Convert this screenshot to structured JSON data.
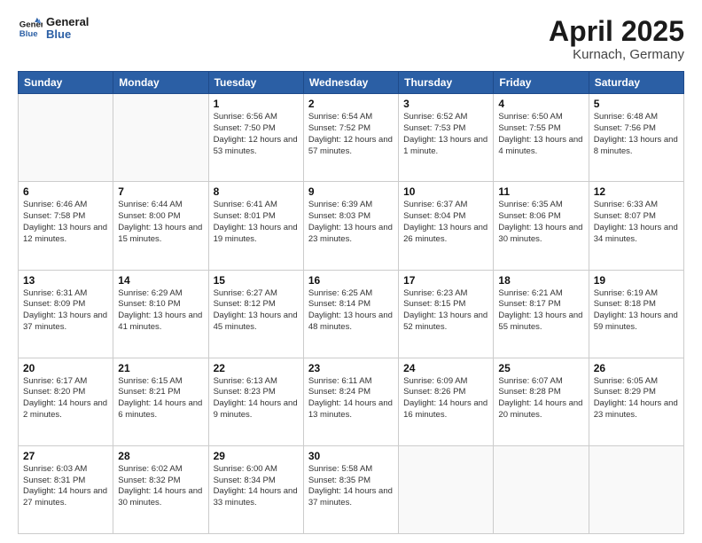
{
  "header": {
    "logo_line1": "General",
    "logo_line2": "Blue",
    "month": "April 2025",
    "location": "Kurnach, Germany"
  },
  "days_of_week": [
    "Sunday",
    "Monday",
    "Tuesday",
    "Wednesday",
    "Thursday",
    "Friday",
    "Saturday"
  ],
  "weeks": [
    [
      {
        "day": "",
        "info": ""
      },
      {
        "day": "",
        "info": ""
      },
      {
        "day": "1",
        "info": "Sunrise: 6:56 AM\nSunset: 7:50 PM\nDaylight: 12 hours\nand 53 minutes."
      },
      {
        "day": "2",
        "info": "Sunrise: 6:54 AM\nSunset: 7:52 PM\nDaylight: 12 hours\nand 57 minutes."
      },
      {
        "day": "3",
        "info": "Sunrise: 6:52 AM\nSunset: 7:53 PM\nDaylight: 13 hours\nand 1 minute."
      },
      {
        "day": "4",
        "info": "Sunrise: 6:50 AM\nSunset: 7:55 PM\nDaylight: 13 hours\nand 4 minutes."
      },
      {
        "day": "5",
        "info": "Sunrise: 6:48 AM\nSunset: 7:56 PM\nDaylight: 13 hours\nand 8 minutes."
      }
    ],
    [
      {
        "day": "6",
        "info": "Sunrise: 6:46 AM\nSunset: 7:58 PM\nDaylight: 13 hours\nand 12 minutes."
      },
      {
        "day": "7",
        "info": "Sunrise: 6:44 AM\nSunset: 8:00 PM\nDaylight: 13 hours\nand 15 minutes."
      },
      {
        "day": "8",
        "info": "Sunrise: 6:41 AM\nSunset: 8:01 PM\nDaylight: 13 hours\nand 19 minutes."
      },
      {
        "day": "9",
        "info": "Sunrise: 6:39 AM\nSunset: 8:03 PM\nDaylight: 13 hours\nand 23 minutes."
      },
      {
        "day": "10",
        "info": "Sunrise: 6:37 AM\nSunset: 8:04 PM\nDaylight: 13 hours\nand 26 minutes."
      },
      {
        "day": "11",
        "info": "Sunrise: 6:35 AM\nSunset: 8:06 PM\nDaylight: 13 hours\nand 30 minutes."
      },
      {
        "day": "12",
        "info": "Sunrise: 6:33 AM\nSunset: 8:07 PM\nDaylight: 13 hours\nand 34 minutes."
      }
    ],
    [
      {
        "day": "13",
        "info": "Sunrise: 6:31 AM\nSunset: 8:09 PM\nDaylight: 13 hours\nand 37 minutes."
      },
      {
        "day": "14",
        "info": "Sunrise: 6:29 AM\nSunset: 8:10 PM\nDaylight: 13 hours\nand 41 minutes."
      },
      {
        "day": "15",
        "info": "Sunrise: 6:27 AM\nSunset: 8:12 PM\nDaylight: 13 hours\nand 45 minutes."
      },
      {
        "day": "16",
        "info": "Sunrise: 6:25 AM\nSunset: 8:14 PM\nDaylight: 13 hours\nand 48 minutes."
      },
      {
        "day": "17",
        "info": "Sunrise: 6:23 AM\nSunset: 8:15 PM\nDaylight: 13 hours\nand 52 minutes."
      },
      {
        "day": "18",
        "info": "Sunrise: 6:21 AM\nSunset: 8:17 PM\nDaylight: 13 hours\nand 55 minutes."
      },
      {
        "day": "19",
        "info": "Sunrise: 6:19 AM\nSunset: 8:18 PM\nDaylight: 13 hours\nand 59 minutes."
      }
    ],
    [
      {
        "day": "20",
        "info": "Sunrise: 6:17 AM\nSunset: 8:20 PM\nDaylight: 14 hours\nand 2 minutes."
      },
      {
        "day": "21",
        "info": "Sunrise: 6:15 AM\nSunset: 8:21 PM\nDaylight: 14 hours\nand 6 minutes."
      },
      {
        "day": "22",
        "info": "Sunrise: 6:13 AM\nSunset: 8:23 PM\nDaylight: 14 hours\nand 9 minutes."
      },
      {
        "day": "23",
        "info": "Sunrise: 6:11 AM\nSunset: 8:24 PM\nDaylight: 14 hours\nand 13 minutes."
      },
      {
        "day": "24",
        "info": "Sunrise: 6:09 AM\nSunset: 8:26 PM\nDaylight: 14 hours\nand 16 minutes."
      },
      {
        "day": "25",
        "info": "Sunrise: 6:07 AM\nSunset: 8:28 PM\nDaylight: 14 hours\nand 20 minutes."
      },
      {
        "day": "26",
        "info": "Sunrise: 6:05 AM\nSunset: 8:29 PM\nDaylight: 14 hours\nand 23 minutes."
      }
    ],
    [
      {
        "day": "27",
        "info": "Sunrise: 6:03 AM\nSunset: 8:31 PM\nDaylight: 14 hours\nand 27 minutes."
      },
      {
        "day": "28",
        "info": "Sunrise: 6:02 AM\nSunset: 8:32 PM\nDaylight: 14 hours\nand 30 minutes."
      },
      {
        "day": "29",
        "info": "Sunrise: 6:00 AM\nSunset: 8:34 PM\nDaylight: 14 hours\nand 33 minutes."
      },
      {
        "day": "30",
        "info": "Sunrise: 5:58 AM\nSunset: 8:35 PM\nDaylight: 14 hours\nand 37 minutes."
      },
      {
        "day": "",
        "info": ""
      },
      {
        "day": "",
        "info": ""
      },
      {
        "day": "",
        "info": ""
      }
    ]
  ]
}
